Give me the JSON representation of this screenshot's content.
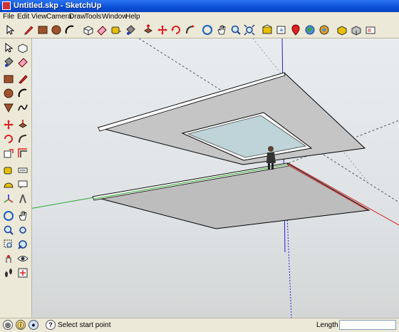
{
  "window": {
    "title": "Untitled.skp - SketchUp"
  },
  "menu": [
    "File",
    "Edit",
    "View",
    "Camera",
    "Draw",
    "Tools",
    "Window",
    "Help"
  ],
  "status": {
    "message": "Select start point",
    "length_label": "Length",
    "length_value": ""
  },
  "colors": {
    "axis_red": "#d42020",
    "axis_green": "#2aa52a",
    "axis_blue": "#2020d4"
  }
}
